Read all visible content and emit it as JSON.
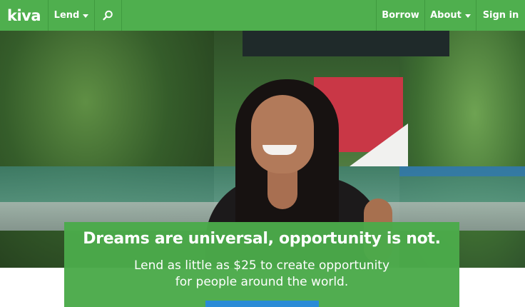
{
  "nav": {
    "logo": "kiva",
    "lend_label": "Lend",
    "borrow_label": "Borrow",
    "about_label": "About",
    "signin_label": "Sign in",
    "search_icon": "search-icon",
    "dropdown_icon": "caret-down-icon"
  },
  "hero": {
    "headline": "Dreams are universal, opportunity is not.",
    "subline_1": "Lend as little as $25 to create opportunity",
    "subline_2": "for people around the world."
  },
  "colors": {
    "brand_green": "#4faf4e",
    "cta_blue": "#2a8bd6"
  }
}
